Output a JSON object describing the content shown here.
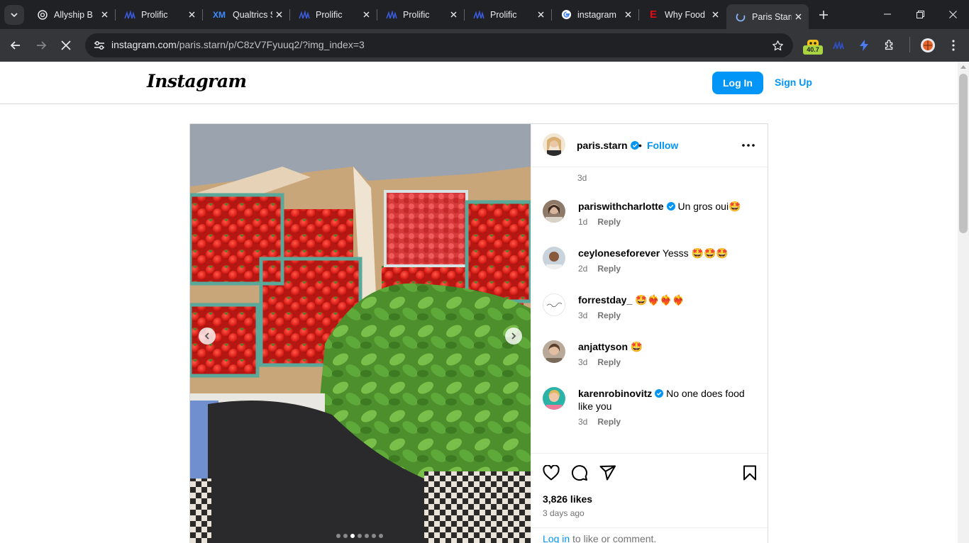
{
  "browser": {
    "tabs": [
      {
        "title": "Allyship B",
        "favicon": "openai-icon"
      },
      {
        "title": "Prolific",
        "favicon": "prolific-icon"
      },
      {
        "title": "Qualtrics S",
        "favicon": "qualtrics-icon"
      },
      {
        "title": "Prolific",
        "favicon": "prolific-icon"
      },
      {
        "title": "Prolific",
        "favicon": "prolific-icon"
      },
      {
        "title": "Prolific",
        "favicon": "prolific-icon"
      },
      {
        "title": "instagram",
        "favicon": "google-icon"
      },
      {
        "title": "Why Food",
        "favicon": "e-icon"
      },
      {
        "title": "Paris Starn",
        "favicon": "instagram-loading-icon",
        "active": true
      }
    ],
    "url_host": "instagram.com",
    "url_path": "/paris.starn/p/C8zV7Fyuuq2/?img_index=3",
    "extension_badge": "40.7"
  },
  "instagram": {
    "logo_text": "Instagram",
    "login_label": "Log In",
    "signup_label": "Sign Up",
    "post": {
      "owner": "paris.starn",
      "owner_verified": true,
      "separator": "•",
      "follow_label": "Follow",
      "caption_time": "3d",
      "comments": [
        {
          "user": "pariswithcharlotte",
          "verified": true,
          "text": "Un gros oui🤩",
          "time": "1d",
          "reply": "Reply"
        },
        {
          "user": "ceyloneseforever",
          "verified": false,
          "text": "Yesss 🤩🤩🤩",
          "time": "2d",
          "reply": "Reply"
        },
        {
          "user": "forrestday_",
          "verified": false,
          "text": "🤩❤️‍🔥❤️‍🔥❤️‍🔥",
          "time": "3d",
          "reply": "Reply"
        },
        {
          "user": "anjattyson",
          "verified": false,
          "text": "🤩",
          "time": "3d",
          "reply": "Reply"
        },
        {
          "user": "karenrobinovitz",
          "verified": true,
          "text": "No one does food like you",
          "time": "3d",
          "reply": "Reply"
        }
      ],
      "likes": "3,826 likes",
      "posted": "3 days ago",
      "login_link": "Log in",
      "login_suffix": " to like or comment.",
      "carousel": {
        "count": 7,
        "current_index": 3
      }
    }
  }
}
